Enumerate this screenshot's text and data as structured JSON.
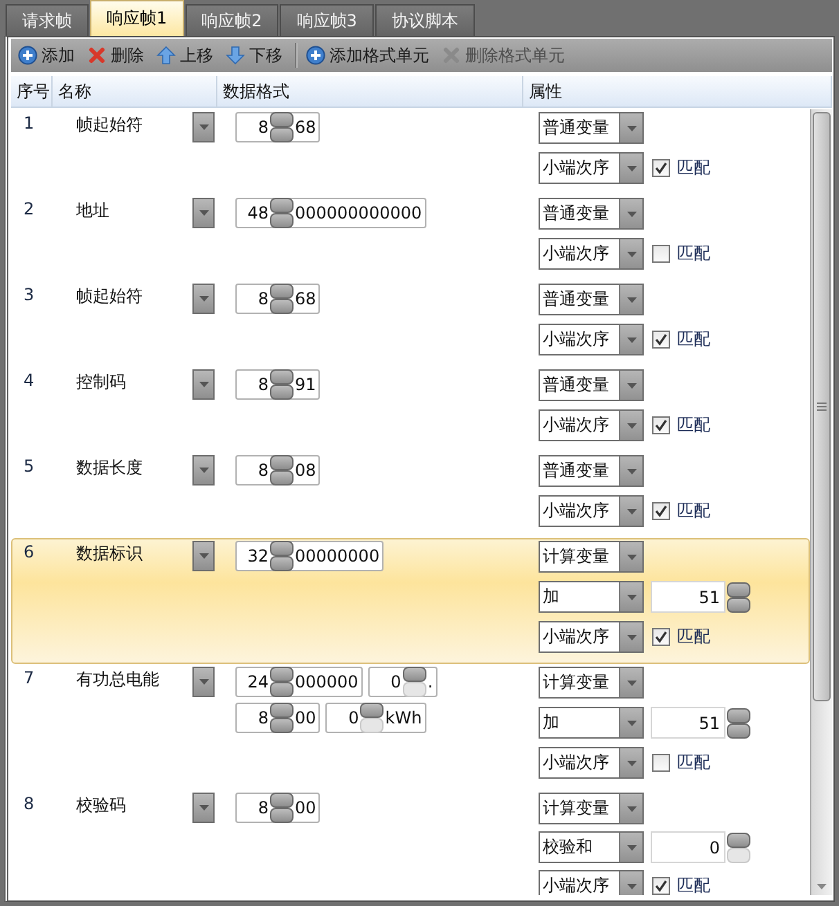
{
  "tabs": [
    {
      "label": "请求帧",
      "selected": false
    },
    {
      "label": "响应帧1",
      "selected": true
    },
    {
      "label": "响应帧2",
      "selected": false
    },
    {
      "label": "响应帧3",
      "selected": false
    },
    {
      "label": "协议脚本",
      "selected": false
    }
  ],
  "toolbar": {
    "groups": [
      [
        {
          "kind": "add",
          "label": "添加",
          "disabled": false
        },
        {
          "kind": "delete",
          "label": "删除",
          "disabled": false
        },
        {
          "kind": "move_up",
          "label": "上移",
          "disabled": false
        },
        {
          "kind": "move_down",
          "label": "下移",
          "disabled": false
        }
      ],
      [
        {
          "kind": "add",
          "label": "添加格式单元",
          "disabled": false
        },
        {
          "kind": "delete",
          "label": "删除格式单元",
          "disabled": true
        }
      ]
    ]
  },
  "table": {
    "columns": [
      "序号",
      "名称",
      "数据格式",
      "属性"
    ],
    "rows": [
      {
        "index": "1",
        "name": "帧起始符",
        "selected": false,
        "format": [
          [
            {
              "bits": "8",
              "value": "68",
              "down_disabled": false
            }
          ]
        ],
        "attributes": [
          {
            "value": "普通变量"
          },
          {
            "value": "小端次序",
            "match": {
              "label": "匹配",
              "checked": true
            }
          }
        ]
      },
      {
        "index": "2",
        "name": "地址",
        "selected": false,
        "format": [
          [
            {
              "bits": "48",
              "value": "000000000000",
              "down_disabled": false
            }
          ]
        ],
        "attributes": [
          {
            "value": "普通变量"
          },
          {
            "value": "小端次序",
            "match": {
              "label": "匹配",
              "checked": false
            }
          }
        ]
      },
      {
        "index": "3",
        "name": "帧起始符",
        "selected": false,
        "format": [
          [
            {
              "bits": "8",
              "value": "68",
              "down_disabled": false
            }
          ]
        ],
        "attributes": [
          {
            "value": "普通变量"
          },
          {
            "value": "小端次序",
            "match": {
              "label": "匹配",
              "checked": true
            }
          }
        ]
      },
      {
        "index": "4",
        "name": "控制码",
        "selected": false,
        "format": [
          [
            {
              "bits": "8",
              "value": "91",
              "down_disabled": false
            }
          ]
        ],
        "attributes": [
          {
            "value": "普通变量"
          },
          {
            "value": "小端次序",
            "match": {
              "label": "匹配",
              "checked": true
            }
          }
        ]
      },
      {
        "index": "5",
        "name": "数据长度",
        "selected": false,
        "format": [
          [
            {
              "bits": "8",
              "value": "08",
              "down_disabled": false
            }
          ]
        ],
        "attributes": [
          {
            "value": "普通变量"
          },
          {
            "value": "小端次序",
            "match": {
              "label": "匹配",
              "checked": true
            }
          }
        ]
      },
      {
        "index": "6",
        "name": "数据标识",
        "selected": true,
        "format": [
          [
            {
              "bits": "32",
              "value": "00000000",
              "down_disabled": false
            }
          ]
        ],
        "attributes": [
          {
            "value": "计算变量"
          },
          {
            "value": "加",
            "number": {
              "value": "51",
              "down_disabled": false
            }
          },
          {
            "value": "小端次序",
            "match": {
              "label": "匹配",
              "checked": true
            }
          }
        ]
      },
      {
        "index": "7",
        "name": "有功总电能",
        "selected": false,
        "format": [
          [
            {
              "bits": "24",
              "value": "000000",
              "down_disabled": false
            },
            {
              "bits": "0",
              "value": ".",
              "down_disabled": true
            }
          ],
          [
            {
              "bits": "8",
              "value": "00",
              "down_disabled": false
            },
            {
              "bits": "0",
              "value": "kWh",
              "down_disabled": true
            }
          ]
        ],
        "attributes": [
          {
            "value": "计算变量"
          },
          {
            "value": "加",
            "number": {
              "value": "51",
              "down_disabled": false
            }
          },
          {
            "value": "小端次序",
            "match": {
              "label": "匹配",
              "checked": false
            }
          }
        ]
      },
      {
        "index": "8",
        "name": "校验码",
        "selected": false,
        "format": [
          [
            {
              "bits": "8",
              "value": "00",
              "down_disabled": false
            }
          ]
        ],
        "attributes": [
          {
            "value": "计算变量"
          },
          {
            "value": "校验和",
            "number": {
              "value": "0",
              "down_disabled": true
            }
          },
          {
            "value": "小端次序",
            "match": {
              "label": "匹配",
              "checked": true
            }
          }
        ]
      }
    ]
  }
}
